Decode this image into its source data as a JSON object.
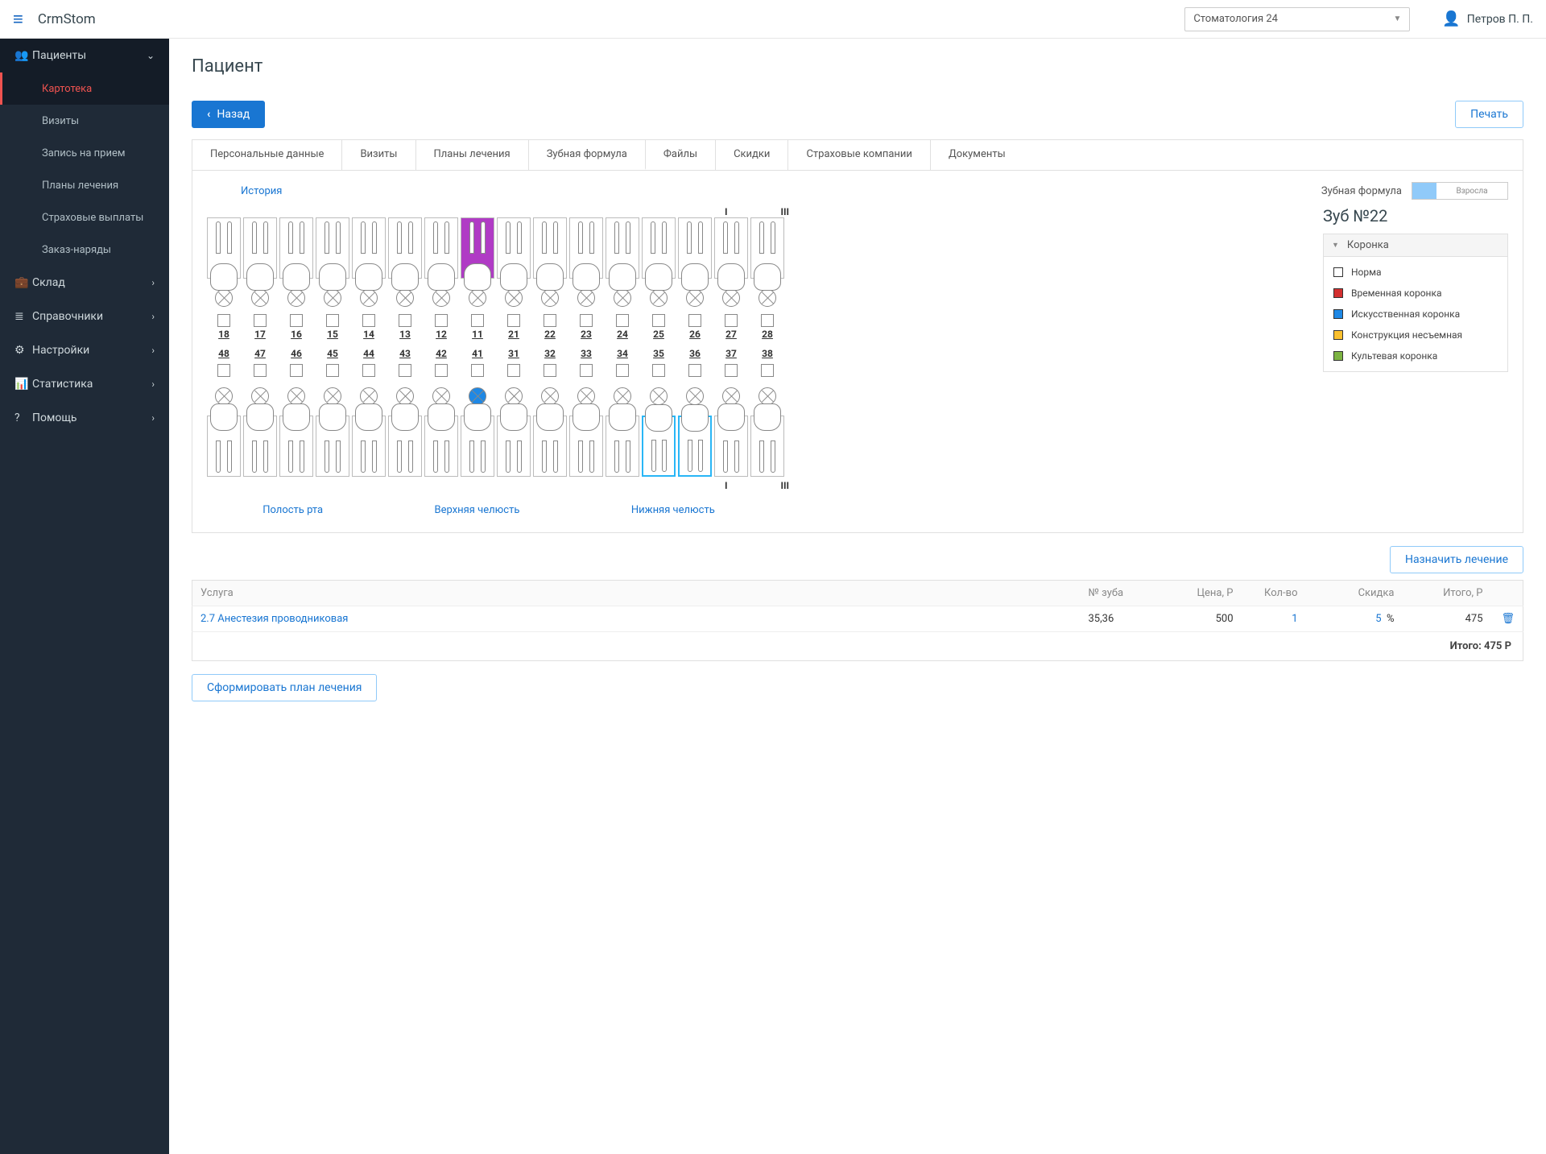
{
  "header": {
    "brand": "CrmStom",
    "clinic": "Стоматология 24",
    "user": "Петров П. П."
  },
  "sidebar": {
    "patients": {
      "label": "Пациенты"
    },
    "sub": {
      "kartoteka": "Картотека",
      "visits": "Визиты",
      "appoint": "Запись на прием",
      "plans": "Планы лечения",
      "insurance": "Страховые выплаты",
      "orders": "Заказ-наряды"
    },
    "stock": "Склад",
    "refs": "Справочники",
    "settings": "Настройки",
    "stats": "Статистика",
    "help": "Помощь"
  },
  "page": {
    "title": "Пациент",
    "back": "Назад",
    "print": "Печать"
  },
  "tabs": {
    "personal": "Персональные данные",
    "visits": "Визиты",
    "plans": "Планы лечения",
    "formula": "Зубная формула",
    "files": "Файлы",
    "discounts": "Скидки",
    "insurance": "Страховые компании",
    "docs": "Документы"
  },
  "formula": {
    "history": "История",
    "label": "Зубная формула",
    "toggle": "Взросла",
    "marker1": "I",
    "marker2": "III",
    "upper_numbers": [
      "18",
      "17",
      "16",
      "15",
      "14",
      "13",
      "12",
      "11",
      "21",
      "22",
      "23",
      "24",
      "25",
      "26",
      "27",
      "28"
    ],
    "lower_numbers": [
      "48",
      "47",
      "46",
      "45",
      "44",
      "43",
      "42",
      "41",
      "31",
      "32",
      "33",
      "34",
      "35",
      "36",
      "37",
      "38"
    ],
    "jaw": {
      "cavity": "Полость рта",
      "upper": "Верхняя челюсть",
      "lower": "Нижняя челюсть"
    },
    "highlighted_purple_index": 7,
    "filled_circle_lower_index": 7,
    "blue_lower_indices": [
      12,
      13
    ]
  },
  "tooth_panel": {
    "title": "Зуб №22",
    "section": "Коронка",
    "items": [
      {
        "label": "Норма",
        "color": "#ffffff"
      },
      {
        "label": "Временная коронка",
        "color": "#d32f2f"
      },
      {
        "label": "Искусственная коронка",
        "color": "#1e88e5"
      },
      {
        "label": "Конструкция несъемная",
        "color": "#fbc02d"
      },
      {
        "label": "Культевая коронка",
        "color": "#7cb342"
      }
    ]
  },
  "assign": {
    "button": "Назначить лечение"
  },
  "table": {
    "headers": {
      "service": "Услуга",
      "tooth": "№ зуба",
      "price": "Цена, Р",
      "qty": "Кол-во",
      "discount": "Скидка",
      "total": "Итого, Р"
    },
    "rows": [
      {
        "service": "2.7 Анестезия проводниковая",
        "tooth": "35,36",
        "price": "500",
        "qty": "1",
        "discount": "5",
        "discount_unit": "%",
        "total": "475"
      }
    ],
    "grand_total": "Итого: 475 Р"
  },
  "form_plan": "Сформировать план лечения"
}
